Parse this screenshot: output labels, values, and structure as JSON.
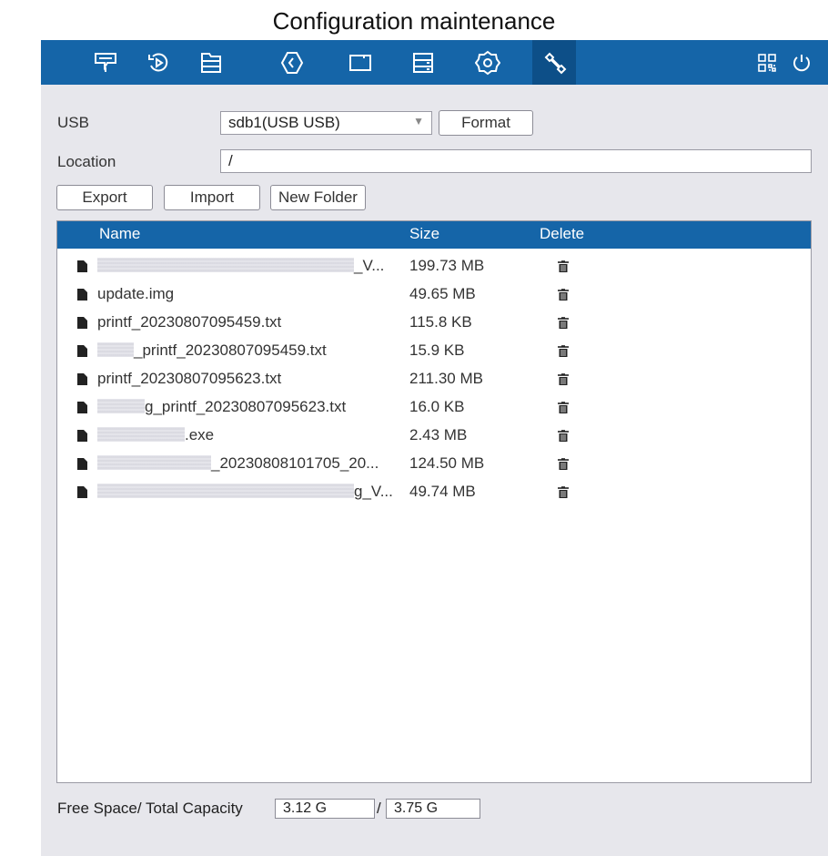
{
  "page_title": "Configuration maintenance",
  "toolbar": {
    "icons": [
      "display-icon",
      "playback-icon",
      "file-icon",
      "alarm-icon",
      "channel-icon",
      "storage-icon",
      "settings-icon",
      "maintenance-icon"
    ],
    "active_index": 7,
    "right_icons": [
      "qr-code-icon",
      "power-icon"
    ]
  },
  "usb": {
    "label": "USB",
    "selected": "sdb1(USB USB)",
    "format_label": "Format"
  },
  "location": {
    "label": "Location",
    "value": "/"
  },
  "actions": {
    "export": "Export",
    "import": "Import",
    "new_folder": "New Folder"
  },
  "table": {
    "headers": {
      "name": "Name",
      "size": "Size",
      "delete": "Delete"
    },
    "rows": [
      {
        "prefix": "",
        "name": "_V...",
        "size": "199.73 MB"
      },
      {
        "prefix": "",
        "name": "update.img",
        "size": "49.65 MB"
      },
      {
        "prefix": "",
        "name": "printf_20230807095459.txt",
        "size": "115.8 KB"
      },
      {
        "prefix": "",
        "name": "_printf_20230807095459.txt",
        "size": "15.9 KB"
      },
      {
        "prefix": "",
        "name": "printf_20230807095623.txt",
        "size": "211.30 MB"
      },
      {
        "prefix": "",
        "name": "g_printf_20230807095623.txt",
        "size": "16.0 KB"
      },
      {
        "prefix": "",
        "name": ".exe",
        "size": "2.43 MB"
      },
      {
        "prefix": "",
        "name": "_20230808101705_20...",
        "size": "124.50 MB"
      },
      {
        "prefix": "",
        "name": "g_V...",
        "size": "49.74 MB"
      }
    ]
  },
  "capacity": {
    "label": "Free Space/ Total Capacity",
    "free": "3.12 G",
    "separator": "/",
    "total": "3.75 G"
  },
  "colors": {
    "accent": "#1565a8",
    "active_tab": "#0d4f88",
    "panel": "#e7e7ec"
  }
}
